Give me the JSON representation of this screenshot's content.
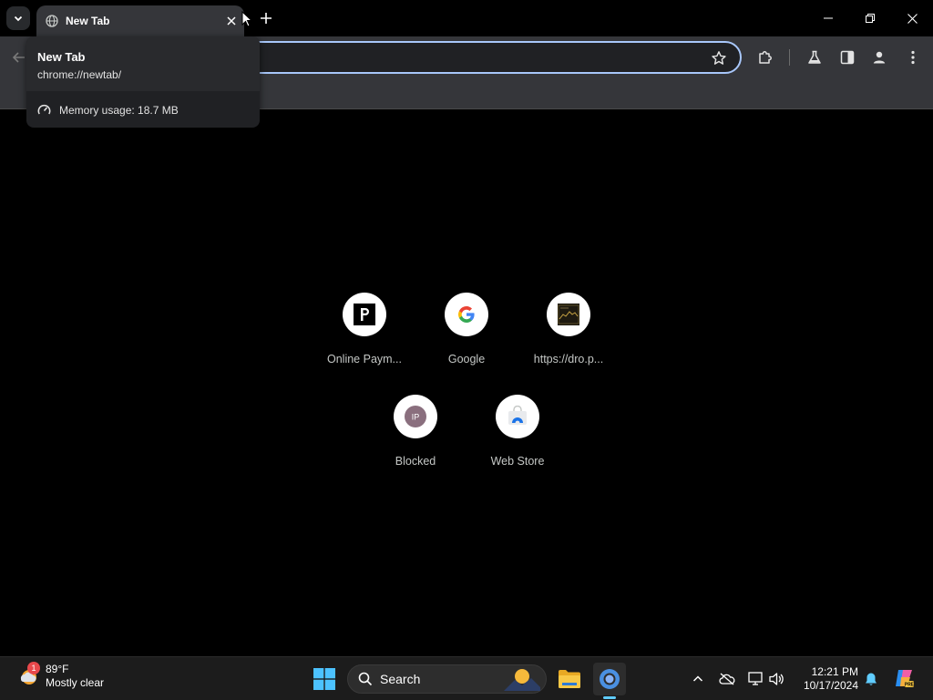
{
  "browser": {
    "tab": {
      "title": "New Tab"
    },
    "hover_card": {
      "title": "New Tab",
      "url": "chrome://newtab/",
      "memory": "Memory usage: 18.7 MB"
    }
  },
  "shortcuts": [
    {
      "label": "Online Paym...",
      "icon": "p-logo-icon"
    },
    {
      "label": "Google",
      "icon": "google-logo-icon"
    },
    {
      "label": "https://dro.p...",
      "icon": "site-thumbnail-icon"
    },
    {
      "label": "Blocked",
      "icon": "ip-badge-icon"
    },
    {
      "label": "Web Store",
      "icon": "web-store-icon"
    }
  ],
  "taskbar": {
    "weather": {
      "temp": "89°F",
      "desc": "Mostly clear",
      "badge": "1"
    },
    "search_label": "Search",
    "clock": {
      "time": "12:21 PM",
      "date": "10/17/2024"
    }
  },
  "colors": {
    "accent": "#a8c7fa",
    "toolbar": "#35363a",
    "taskbar": "#1c1c1c"
  }
}
